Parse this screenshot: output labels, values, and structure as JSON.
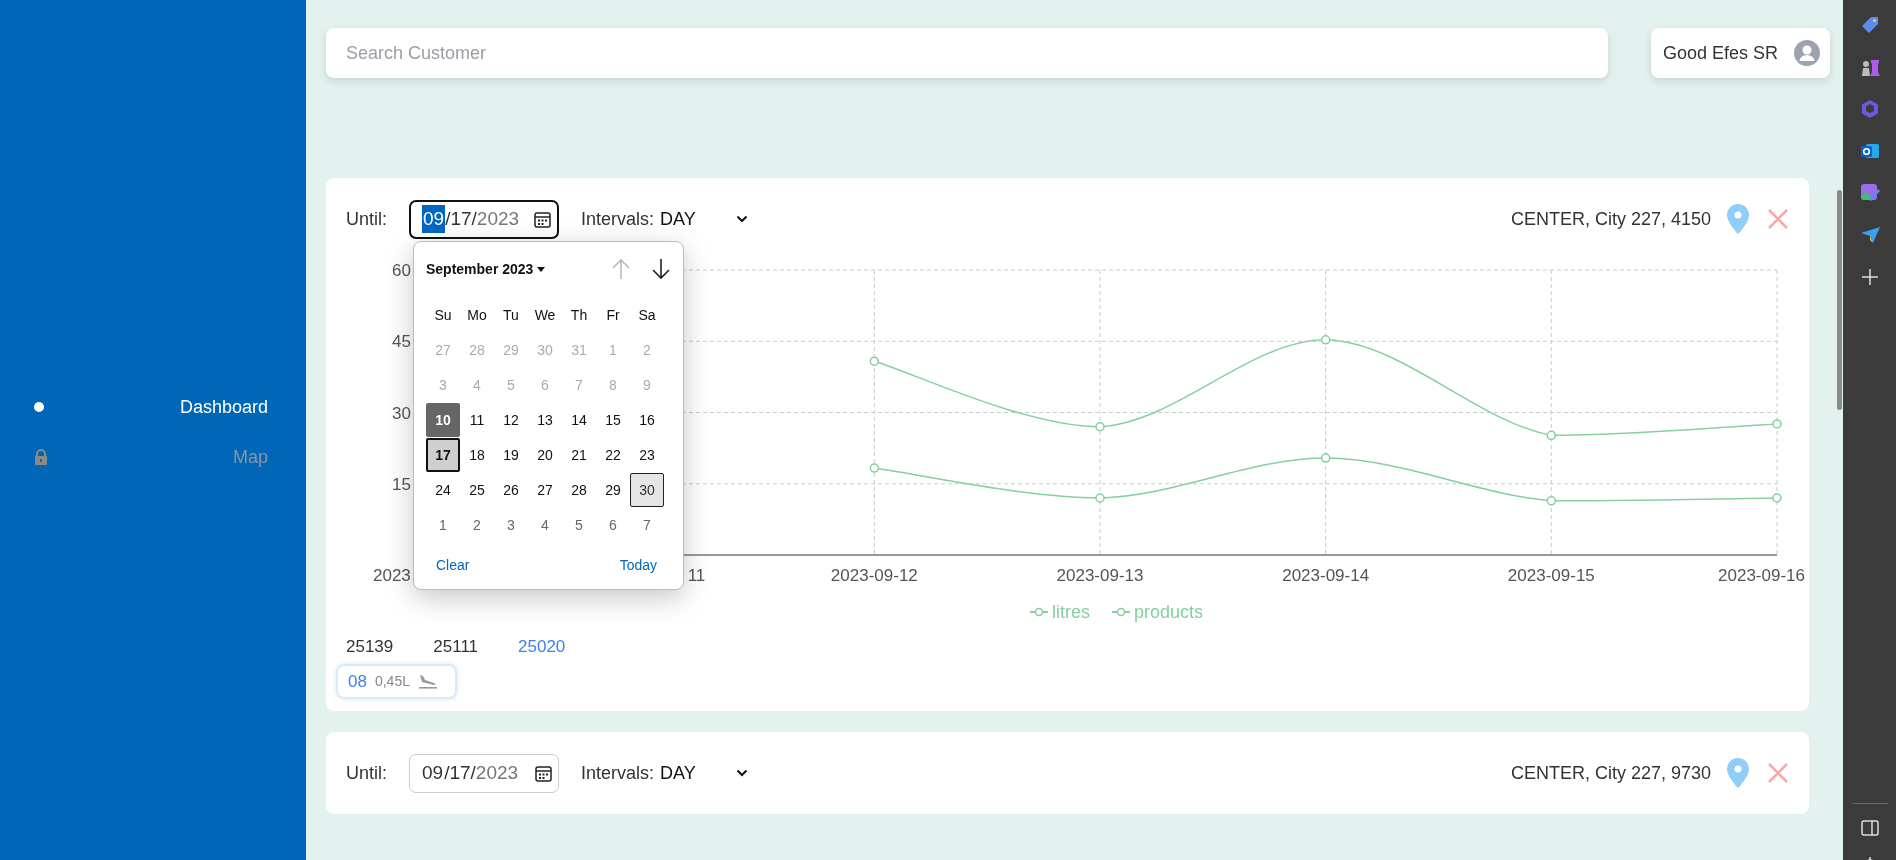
{
  "sidebar": {
    "items": [
      {
        "label": "Dashboard",
        "selected": true,
        "locked": false
      },
      {
        "label": "Map",
        "selected": false,
        "locked": true
      }
    ]
  },
  "search": {
    "placeholder": "Search Customer"
  },
  "user": {
    "name": "Good Efes SR"
  },
  "cards": [
    {
      "until_label": "Until:",
      "date_focused": true,
      "date": [
        {
          "text": "09",
          "kind": "value",
          "selected": true
        },
        {
          "text": "/",
          "kind": "value",
          "selected": false
        },
        {
          "text": "17",
          "kind": "value",
          "selected": false
        },
        {
          "text": "/",
          "kind": "value",
          "selected": false
        },
        {
          "text": "2023",
          "kind": "faint",
          "selected": false
        }
      ],
      "intervals_label": "Intervals:",
      "interval": "DAY",
      "location": "CENTER, City 227, 4150",
      "calendar": {
        "title": "September 2023",
        "weekdays": [
          "Su",
          "Mo",
          "Tu",
          "We",
          "Th",
          "Fr",
          "Sa"
        ],
        "weeks": [
          [
            {
              "label": "27",
              "kind": "disabled",
              "selected": false
            },
            {
              "label": "28",
              "kind": "disabled",
              "selected": false
            },
            {
              "label": "29",
              "kind": "disabled",
              "selected": false
            },
            {
              "label": "30",
              "kind": "disabled",
              "selected": false
            },
            {
              "label": "31",
              "kind": "disabled",
              "selected": false
            },
            {
              "label": "1",
              "kind": "disabled",
              "selected": false
            },
            {
              "label": "2",
              "kind": "disabled",
              "selected": false
            }
          ],
          [
            {
              "label": "3",
              "kind": "disabled",
              "selected": false
            },
            {
              "label": "4",
              "kind": "disabled",
              "selected": false
            },
            {
              "label": "5",
              "kind": "disabled",
              "selected": false
            },
            {
              "label": "6",
              "kind": "disabled",
              "selected": false
            },
            {
              "label": "7",
              "kind": "disabled",
              "selected": false
            },
            {
              "label": "8",
              "kind": "disabled",
              "selected": false
            },
            {
              "label": "9",
              "kind": "disabled",
              "selected": false
            }
          ],
          [
            {
              "label": "10",
              "kind": "start",
              "selected": false
            },
            {
              "label": "11",
              "kind": "day",
              "selected": false
            },
            {
              "label": "12",
              "kind": "day",
              "selected": false
            },
            {
              "label": "13",
              "kind": "day",
              "selected": false
            },
            {
              "label": "14",
              "kind": "day",
              "selected": false
            },
            {
              "label": "15",
              "kind": "day",
              "selected": false
            },
            {
              "label": "16",
              "kind": "day",
              "selected": false
            }
          ],
          [
            {
              "label": "17",
              "kind": "day",
              "selected": true
            },
            {
              "label": "18",
              "kind": "day",
              "selected": false
            },
            {
              "label": "19",
              "kind": "day",
              "selected": false
            },
            {
              "label": "20",
              "kind": "day",
              "selected": false
            },
            {
              "label": "21",
              "kind": "day",
              "selected": false
            },
            {
              "label": "22",
              "kind": "day",
              "selected": false
            },
            {
              "label": "23",
              "kind": "day",
              "selected": false
            }
          ],
          [
            {
              "label": "24",
              "kind": "day",
              "selected": false
            },
            {
              "label": "25",
              "kind": "day",
              "selected": false
            },
            {
              "label": "26",
              "kind": "day",
              "selected": false
            },
            {
              "label": "27",
              "kind": "day",
              "selected": false
            },
            {
              "label": "28",
              "kind": "day",
              "selected": false
            },
            {
              "label": "29",
              "kind": "day",
              "selected": false
            },
            {
              "label": "30",
              "kind": "focused",
              "selected": false
            }
          ],
          [
            {
              "label": "1",
              "kind": "outside",
              "selected": false
            },
            {
              "label": "2",
              "kind": "outside",
              "selected": false
            },
            {
              "label": "3",
              "kind": "outside",
              "selected": false
            },
            {
              "label": "4",
              "kind": "outside",
              "selected": false
            },
            {
              "label": "5",
              "kind": "outside",
              "selected": false
            },
            {
              "label": "6",
              "kind": "outside",
              "selected": false
            },
            {
              "label": "7",
              "kind": "outside",
              "selected": false
            }
          ]
        ],
        "clear": "Clear",
        "today": "Today"
      },
      "line_chart": {
        "y_labels": [
          "60",
          "45",
          "30",
          "15"
        ],
        "x_labels": [
          "2023",
          "11",
          "2023-09-12",
          "2023-09-13",
          "2023-09-14",
          "2023-09-15",
          "2023-09-16"
        ],
        "series": [
          {
            "name": "litres",
            "color": "#86cfa0"
          },
          {
            "name": "products",
            "color": "#86cfa0"
          }
        ]
      },
      "tabs": [
        {
          "label": "25139",
          "selected": false
        },
        {
          "label": "25111",
          "selected": false
        },
        {
          "label": "25020",
          "selected": true
        }
      ],
      "chips": [
        {
          "code": "08",
          "volume": "0,45L"
        }
      ]
    },
    {
      "until_label": "Until:",
      "date_focused": false,
      "date": [
        {
          "text": "09",
          "kind": "value",
          "selected": false
        },
        {
          "text": "/",
          "kind": "value",
          "selected": false
        },
        {
          "text": "17",
          "kind": "value",
          "selected": false
        },
        {
          "text": "/",
          "kind": "value",
          "selected": false
        },
        {
          "text": "2023",
          "kind": "faint",
          "selected": false
        }
      ],
      "intervals_label": "Intervals:",
      "interval": "DAY",
      "location": "CENTER, City 227, 9730"
    }
  ]
}
